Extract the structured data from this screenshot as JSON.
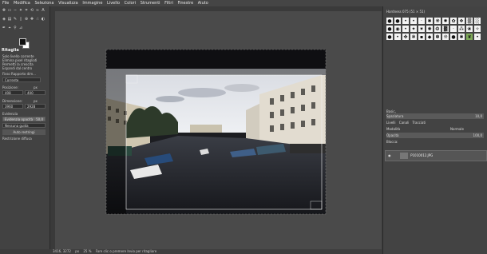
{
  "menu": [
    "File",
    "Modifica",
    "Seleziona",
    "Visualizza",
    "Immagine",
    "Livello",
    "Colori",
    "Strumenti",
    "Filtri",
    "Finestre",
    "Aiuto"
  ],
  "tool_options": {
    "title": "Ritaglia",
    "items": [
      "Solo livello corrente",
      "Elimina pixel ritagliati",
      "Permetti la crescita",
      "Espandi dal centro"
    ],
    "fixed": "Fisso Rapporto dim...",
    "current": "Corrente",
    "position_label": "Posizione:",
    "unit": "px",
    "pos_x": "408",
    "pos_y": "400",
    "size_label": "Dimensione:",
    "size_w": "3960",
    "size_h": "2928",
    "evidenzia": "Evidenzia",
    "opacity_label": "Evidenzia opacità",
    "opacity_value": "50,0",
    "guide": "Nessuna guida",
    "auto": "Auto restringi",
    "restrict": "Restrizione diffusa"
  },
  "brushes": {
    "title": "Hardness 075 (51 × 51)",
    "filter": "Basic,",
    "spacing_label": "Spaziatura",
    "spacing_value": "10,0"
  },
  "layers": {
    "tabs": [
      "Livelli",
      "Canali",
      "Tracciati"
    ],
    "mode_label": "Modalità",
    "mode_value": "Normale",
    "opacity_label": "Opacità",
    "opacity_value": "100,0",
    "lock_label": "Blocca:",
    "layer_name": "P1010012.JPG"
  },
  "status": {
    "coords": "3416, 3272",
    "unit": "px",
    "zoom": "25 %",
    "message": "Fare clic o premere Invio per ritagliare"
  }
}
